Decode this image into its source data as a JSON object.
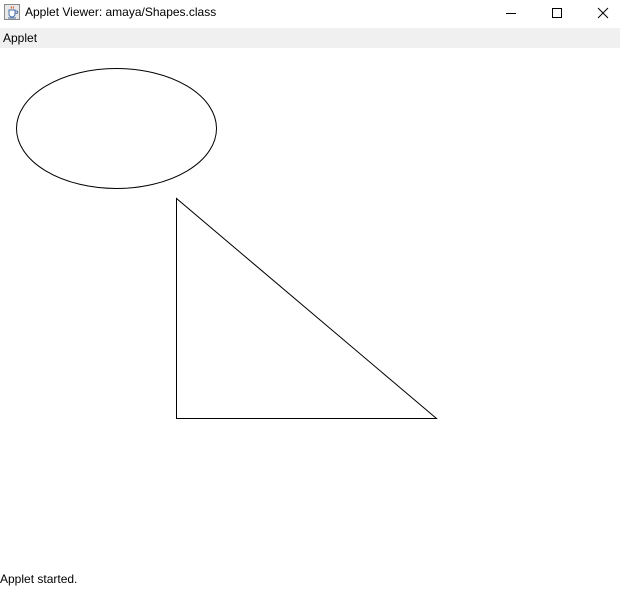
{
  "window": {
    "title": "Applet Viewer: amaya/Shapes.class",
    "app_icon": "java-cup-icon",
    "controls": {
      "minimize": "minimize-icon",
      "maximize": "maximize-icon",
      "close": "close-icon"
    }
  },
  "menubar": {
    "items": [
      {
        "label": "Applet"
      }
    ]
  },
  "canvas": {
    "background": "#ffffff",
    "stroke_color": "#000000",
    "shapes": [
      "ellipse",
      "right-triangle"
    ]
  },
  "status": {
    "text": "Applet started."
  }
}
